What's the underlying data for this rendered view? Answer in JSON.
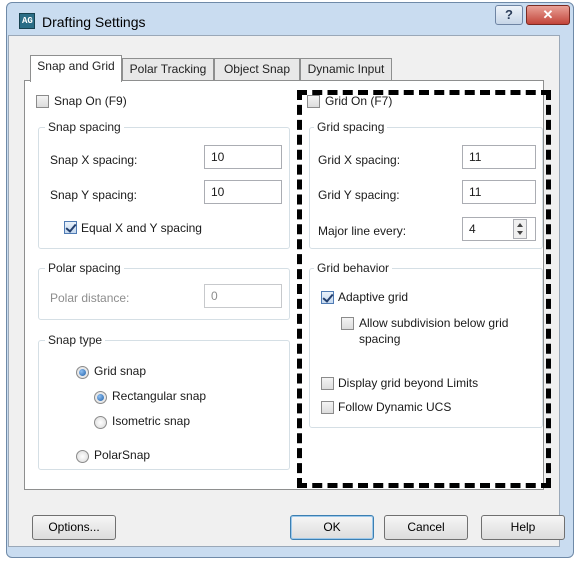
{
  "window": {
    "title": "Drafting Settings",
    "help_glyph": "?",
    "close_glyph": "✕",
    "app_icon_glyph": "AG"
  },
  "tabs": [
    {
      "label": "Snap and Grid",
      "active": true
    },
    {
      "label": "Polar Tracking"
    },
    {
      "label": "Object Snap"
    },
    {
      "label": "Dynamic Input"
    }
  ],
  "snap": {
    "snap_on_label": "Snap On (F9)",
    "snap_on_checked": false,
    "spacing_title": "Snap spacing",
    "x_label": "Snap X spacing:",
    "x_value": "10",
    "y_label": "Snap Y spacing:",
    "y_value": "10",
    "equal_label": "Equal X and Y spacing",
    "equal_checked": true
  },
  "polar": {
    "title": "Polar spacing",
    "distance_label": "Polar distance:",
    "distance_value": "0"
  },
  "snap_type": {
    "title": "Snap type",
    "grid_snap": "Grid snap",
    "rectangular": "Rectangular snap",
    "isometric": "Isometric snap",
    "polarsnap": "PolarSnap"
  },
  "grid": {
    "grid_on_label": "Grid On (F7)",
    "grid_on_checked": false,
    "spacing_title": "Grid spacing",
    "x_label": "Grid X spacing:",
    "x_value": "11",
    "y_label": "Grid Y spacing:",
    "y_value": "11",
    "major_label": "Major line every:",
    "major_value": "4"
  },
  "grid_behavior": {
    "title": "Grid behavior",
    "adaptive": "Adaptive grid",
    "adaptive_checked": true,
    "subdivision_line1": "Allow subdivision below grid",
    "subdivision_line2": "spacing",
    "subdivision_checked": false,
    "beyond_limits": "Display grid beyond Limits",
    "beyond_limits_checked": false,
    "follow_ucs": "Follow Dynamic UCS",
    "follow_ucs_checked": false
  },
  "buttons": {
    "options": "Options...",
    "ok": "OK",
    "cancel": "Cancel",
    "help": "Help"
  },
  "colors": {
    "window_frame": "#c9dcf0",
    "client_bg": "#f0f0f0",
    "highlight_border": "#000000",
    "close_button": "#c2453a"
  }
}
